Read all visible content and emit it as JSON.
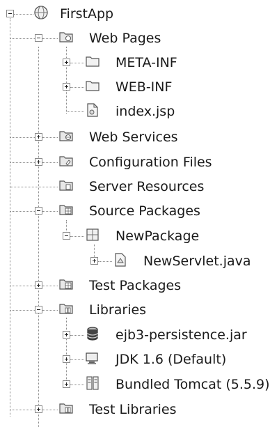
{
  "tree": {
    "root": {
      "label": "FirstApp",
      "icon": "project-globe-icon",
      "expanded": true
    },
    "web_pages": {
      "label": "Web Pages",
      "icon": "web-pages-folder-icon",
      "expanded": true
    },
    "meta_inf": {
      "label": "META-INF",
      "icon": "folder-icon",
      "expanded": false
    },
    "web_inf": {
      "label": "WEB-INF",
      "icon": "folder-icon",
      "expanded": false
    },
    "index_jsp": {
      "label": "index.jsp",
      "icon": "jsp-file-icon"
    },
    "web_services": {
      "label": "Web Services",
      "icon": "web-services-folder-icon",
      "expanded": false
    },
    "configuration_files": {
      "label": "Configuration Files",
      "icon": "config-folder-icon",
      "expanded": false
    },
    "server_resources": {
      "label": "Server Resources",
      "icon": "server-resources-folder-icon"
    },
    "source_packages": {
      "label": "Source Packages",
      "icon": "source-packages-folder-icon",
      "expanded": true
    },
    "new_package": {
      "label": "NewPackage",
      "icon": "package-icon",
      "expanded": true
    },
    "new_servlet": {
      "label": "NewServlet.java",
      "icon": "java-class-icon",
      "expanded": false
    },
    "test_packages": {
      "label": "Test Packages",
      "icon": "test-packages-folder-icon",
      "expanded": false
    },
    "libraries": {
      "label": "Libraries",
      "icon": "libraries-folder-icon",
      "expanded": true
    },
    "ejb3_jar": {
      "label": "ejb3-persistence.jar",
      "icon": "jar-icon",
      "expanded": false
    },
    "jdk": {
      "label": "JDK 1.6 (Default)",
      "icon": "jdk-icon",
      "expanded": false
    },
    "tomcat": {
      "label": "Bundled Tomcat (5.5.9)",
      "icon": "server-library-icon",
      "expanded": false
    },
    "test_libraries": {
      "label": "Test Libraries",
      "icon": "test-libraries-folder-icon",
      "expanded": false
    }
  }
}
